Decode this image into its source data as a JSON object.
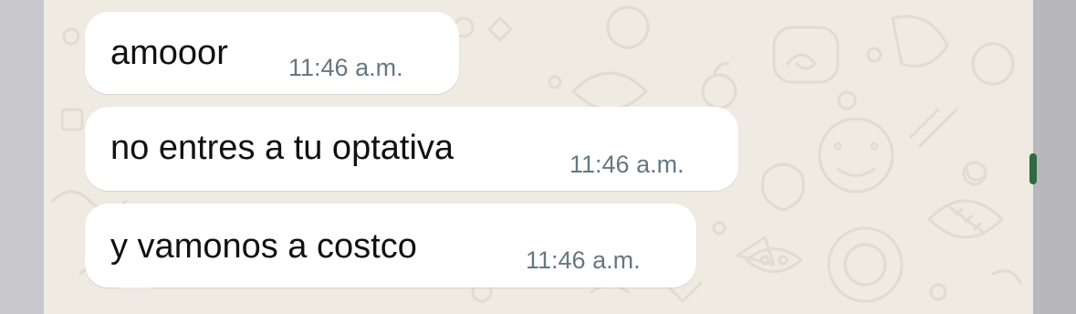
{
  "messages": [
    {
      "text": "amooor",
      "time": "11:46 a.m."
    },
    {
      "text": "no entres a tu optativa",
      "time": "11:46 a.m."
    },
    {
      "text": "y vamonos a costco",
      "time": "11:46 a.m."
    }
  ],
  "colors": {
    "wallpaper": "#efeae2",
    "bubble": "#ffffff",
    "text": "#111111",
    "timestamp": "#667781"
  }
}
